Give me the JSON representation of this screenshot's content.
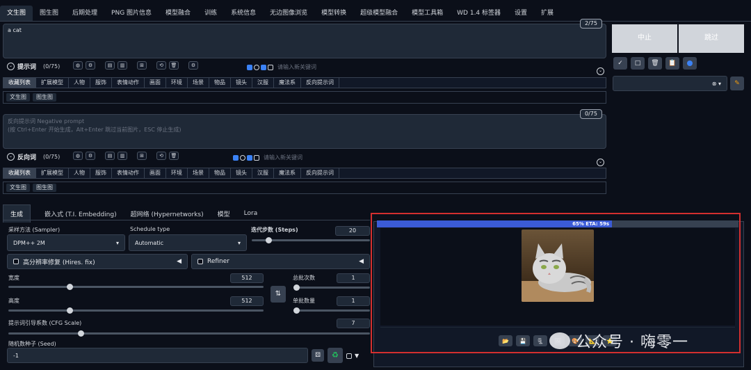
{
  "tabs": [
    "文生图",
    "图生图",
    "后期处理",
    "PNG 图片信息",
    "模型融合",
    "训练",
    "系统信息",
    "无边图像浏览",
    "模型转换",
    "超级模型融合",
    "模型工具箱",
    "WD 1.4 标签器",
    "设置",
    "扩展"
  ],
  "prompt": {
    "value": "a cat",
    "counter": "2/75",
    "label": "提示词",
    "token_count": "(0/75)",
    "keyword_placeholder": "请输入新关键词"
  },
  "negative": {
    "placeholder_line1": "反向提示词 Negative prompt",
    "placeholder_line2": "(按 Ctrl+Enter 开始生成，Alt+Enter 跳过当前图片，ESC 停止生成)",
    "counter": "0/75",
    "label": "反向词",
    "token_count": "(0/75)",
    "keyword_placeholder": "请输入新关键词"
  },
  "categories": [
    "收藏列表",
    "扩展模型",
    "人物",
    "服饰",
    "表情动作",
    "画面",
    "环境",
    "场景",
    "物品",
    "镜头",
    "汉服",
    "魔法系",
    "反向提示词"
  ],
  "subtabs": [
    "文生图",
    "图生图"
  ],
  "actions": {
    "interrupt": "中止",
    "skip": "跳过"
  },
  "settings_tabs": [
    "生成",
    "嵌入式 (T.I. Embedding)",
    "超网络 (Hypernetworks)",
    "模型",
    "Lora"
  ],
  "sampler": {
    "label": "采样方法 (Sampler)",
    "value": "DPM++ 2M"
  },
  "schedule": {
    "label": "Schedule type",
    "value": "Automatic"
  },
  "steps": {
    "label": "迭代步数 (Steps)",
    "value": "20",
    "fraction": 0.14
  },
  "hires": {
    "label": "高分辨率修复 (Hires. fix)"
  },
  "refiner": {
    "label": "Refiner"
  },
  "width": {
    "label": "宽度",
    "value": "512",
    "fraction": 0.24
  },
  "height": {
    "label": "高度",
    "value": "512",
    "fraction": 0.24
  },
  "batch_count": {
    "label": "总批次数",
    "value": "1",
    "fraction": 0.02
  },
  "batch_size": {
    "label": "单批数量",
    "value": "1",
    "fraction": 0.02
  },
  "cfg": {
    "label": "提示词引导系数 (CFG Scale)",
    "value": "7",
    "fraction": 0.2
  },
  "seed": {
    "label": "随机数种子 (Seed)",
    "value": "-1"
  },
  "progress": {
    "text": "65% ETA: 59s",
    "fraction": 0.65
  },
  "watermark": "公众号 · 嗨零一",
  "colors": {
    "accent": "#3b5bd6",
    "highlight": "#d32f2f",
    "bg": "#0b0f19"
  }
}
